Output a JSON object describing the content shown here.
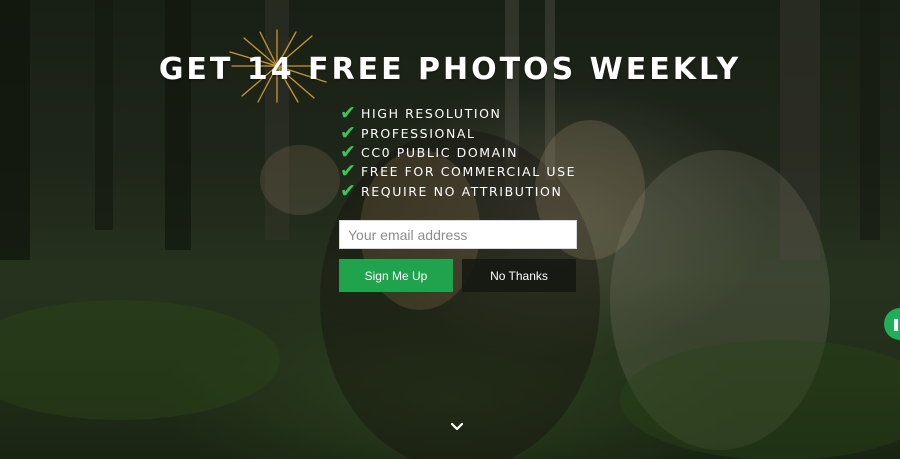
{
  "hero": {
    "title": "GET 14 FREE PHOTOS WEEKLY",
    "features": [
      "HIGH RESOLUTION",
      "PROFESSIONAL",
      "CC0 PUBLIC DOMAIN",
      "FREE FOR COMMERCIAL USE",
      "REQUIRE NO ATTRIBUTION"
    ],
    "check_symbol": "✔"
  },
  "form": {
    "email_placeholder": "Your email address",
    "email_value": "",
    "signup_label": "Sign Me Up",
    "nothanks_label": "No Thanks"
  },
  "icons": {
    "scroll": "chevron-down-icon",
    "chat": "chat-icon",
    "check": "checkmark-icon",
    "sparkle": "sparkle-icon"
  },
  "colors": {
    "accent_green": "#20a34d",
    "check_green": "#3cc35a",
    "chat_green": "#1fae5a",
    "sparkle_gold": "#f2b23c"
  }
}
